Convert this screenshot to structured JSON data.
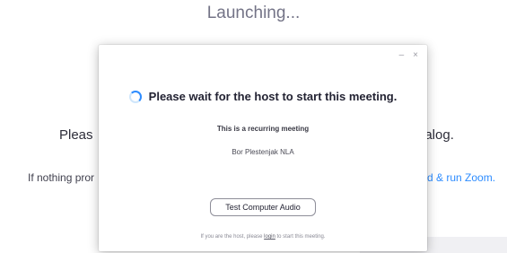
{
  "background": {
    "title": "Launching...",
    "line1_left": "Pleas",
    "line1_right": "ialog.",
    "line2_left": "If nothing pror",
    "line2_right": "d & run Zoom."
  },
  "dialog": {
    "minimize_glyph": "–",
    "close_glyph": "×",
    "wait_message": "Please wait for the host to start this meeting.",
    "recurring_note": "This is a recurring meeting",
    "host_name": "Bor Plestenjak NLA",
    "test_audio_label": "Test Computer Audio",
    "footer_before": "If you are the host, please",
    "footer_link": "login",
    "footer_after": "to start this meeting."
  },
  "colors": {
    "accent": "#2d8cff",
    "title_gray": "#747487",
    "text_dark": "#232333"
  },
  "icons": {
    "spinner": "loading-spinner-icon",
    "minimize": "minimize-icon",
    "close": "close-icon"
  }
}
